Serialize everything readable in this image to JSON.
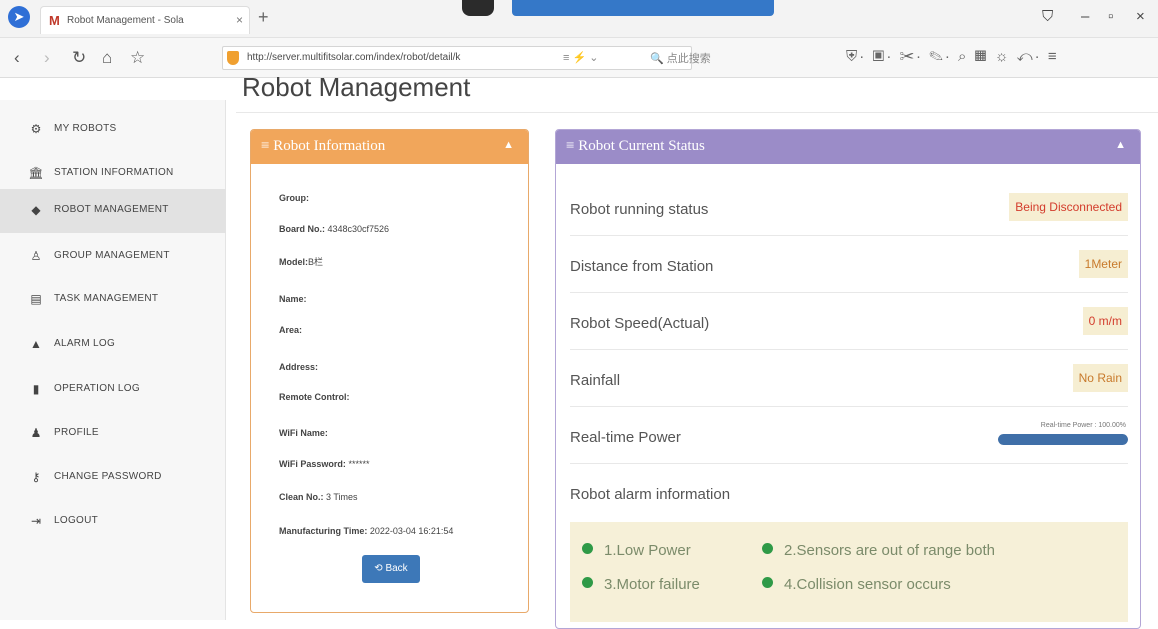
{
  "browser": {
    "tab_title": "Robot Management - Sola",
    "favicon_letter": "M",
    "url": "http://server.multifitsolar.com/index/robot/detail/k",
    "search_placeholder": "点此搜索"
  },
  "sidebar": {
    "items": [
      {
        "label": "MY ROBOTS",
        "icon": "robots-icon",
        "glyph": "⚙",
        "active": false
      },
      {
        "label": "STATION INFORMATION",
        "icon": "bank-icon",
        "glyph": "🏛",
        "active": false
      },
      {
        "label": "ROBOT MANAGEMENT",
        "icon": "diamond-icon",
        "glyph": "◆",
        "active": true
      },
      {
        "label": "GROUP MANAGEMENT",
        "icon": "sitemap-icon",
        "glyph": "♙",
        "active": false
      },
      {
        "label": "TASK MANAGEMENT",
        "icon": "task-icon",
        "glyph": "▤",
        "active": false
      },
      {
        "label": "ALARM LOG",
        "icon": "warning-icon",
        "glyph": "▲",
        "active": false
      },
      {
        "label": "OPERATION LOG",
        "icon": "file-icon",
        "glyph": "▮",
        "active": false
      },
      {
        "label": "PROFILE",
        "icon": "user-icon",
        "glyph": "♟",
        "active": false
      },
      {
        "label": "CHANGE PASSWORD",
        "icon": "key-icon",
        "glyph": "⚷",
        "active": false
      },
      {
        "label": "LOGOUT",
        "icon": "logout-icon",
        "glyph": "⇥",
        "active": false
      }
    ]
  },
  "page": {
    "title": "Robot Management"
  },
  "info_panel": {
    "title": "≡ Robot Information",
    "fields": [
      {
        "label": "Group:",
        "value": ""
      },
      {
        "label": "Board No.:",
        "value": " 4348c30cf7526"
      },
      {
        "label": "Model:",
        "value": "B栏"
      },
      {
        "label": "Name:",
        "value": ""
      },
      {
        "label": "Area:",
        "value": ""
      },
      {
        "label": "Address:",
        "value": ""
      },
      {
        "label": "Remote Control:",
        "value": ""
      },
      {
        "label": "WiFi Name:",
        "value": ""
      },
      {
        "label": "WiFi Password:",
        "value": " ******"
      },
      {
        "label": "Clean No.:",
        "value": " 3 Times"
      },
      {
        "label": "Manufacturing Time:",
        "value": " 2022-03-04 16:21:54"
      }
    ],
    "back_label": "⟲ Back"
  },
  "status_panel": {
    "title": "≡ Robot Current Status",
    "rows": [
      {
        "label": "Robot running status",
        "value": "Being Disconnected",
        "style": "red"
      },
      {
        "label": "Distance from Station",
        "value": "1Meter",
        "style": "orange"
      },
      {
        "label": "Robot Speed(Actual)",
        "value": "0 m/m",
        "style": "red"
      },
      {
        "label": "Rainfall",
        "value": "No Rain",
        "style": "orange"
      }
    ],
    "power": {
      "label": "Real-time Power",
      "mini_text": "Real-time Power : 100.00%",
      "percent": 100
    },
    "alarm_label": "Robot alarm information",
    "alarms": [
      "1.Low Power",
      "2.Sensors are out of range both",
      "3.Motor failure",
      "4.Collision sensor occurs"
    ]
  },
  "colors": {
    "info_header": "#f1a65b",
    "status_header": "#9b8cc8",
    "alarm_dot": "#2f9a47",
    "badge_bg": "#f6eed2"
  }
}
